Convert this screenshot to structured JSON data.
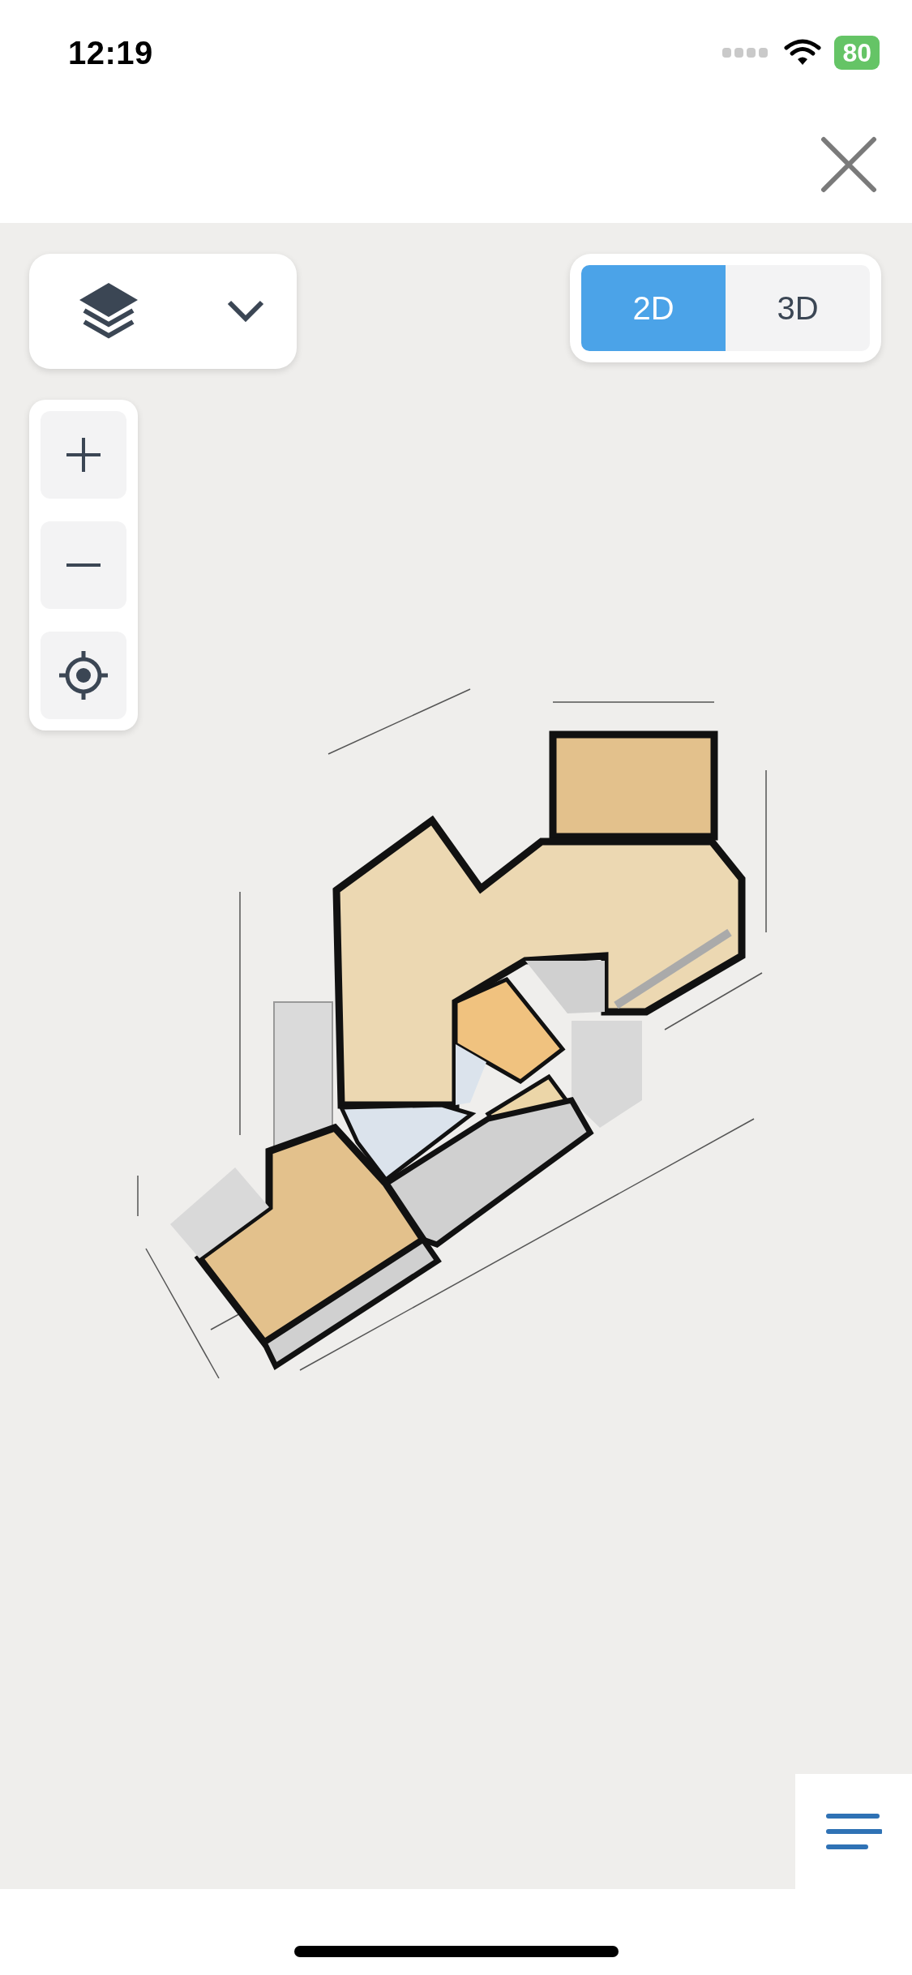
{
  "status_bar": {
    "time": "12:19",
    "battery": "80"
  },
  "view_toggle": [
    {
      "label": "2D",
      "selected": true
    },
    {
      "label": "3D",
      "selected": false
    }
  ]
}
